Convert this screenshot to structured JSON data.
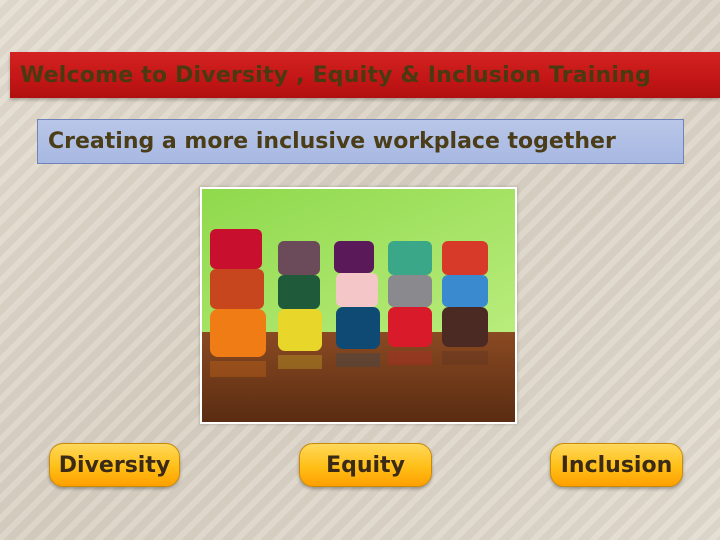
{
  "slide": {
    "title": "Welcome to Diversity , Equity & Inclusion Training",
    "subtitle": "Creating a more inclusive workplace together"
  },
  "image": {
    "icon": "stacked-mugs-photo"
  },
  "buttons": [
    {
      "label": "Diversity"
    },
    {
      "label": "Equity"
    },
    {
      "label": "Inclusion"
    }
  ],
  "colors": {
    "title_bar": "#c81b1b",
    "subtitle_box": "#aebde4",
    "pill": "#ffbf16",
    "text": "#4a3a12"
  }
}
